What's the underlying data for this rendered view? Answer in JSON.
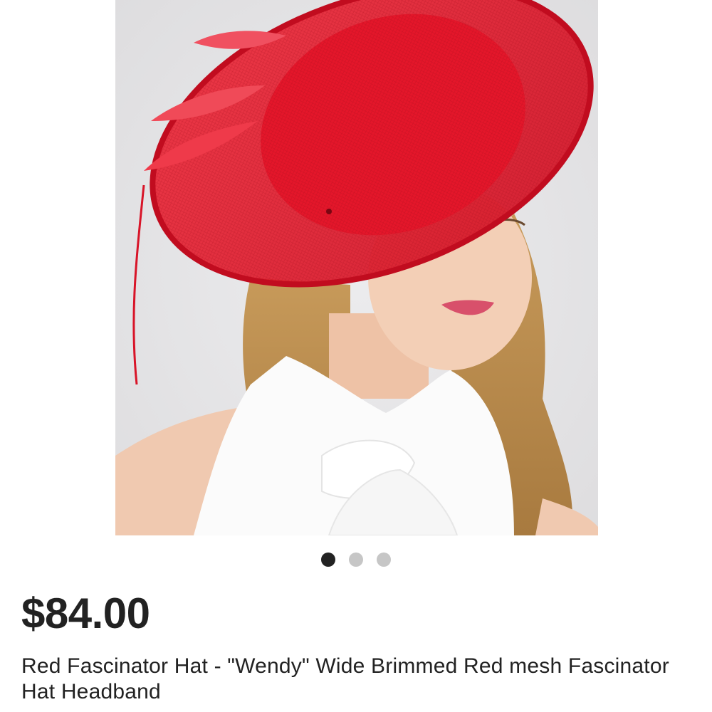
{
  "product": {
    "image_alt": "Model wearing a red wide brimmed mesh fascinator hat",
    "price": "$84.00",
    "title": "Red Fascinator Hat - \"Wendy\" Wide Brimmed Red mesh Fascinator Hat Headband"
  },
  "carousel": {
    "total": 3,
    "active_index": 0
  },
  "colors": {
    "hat_red": "#e5172b",
    "price_text": "#222222",
    "dot_active": "#222222",
    "dot_inactive": "#c6c6c6",
    "image_background": "#e7e6e8"
  }
}
